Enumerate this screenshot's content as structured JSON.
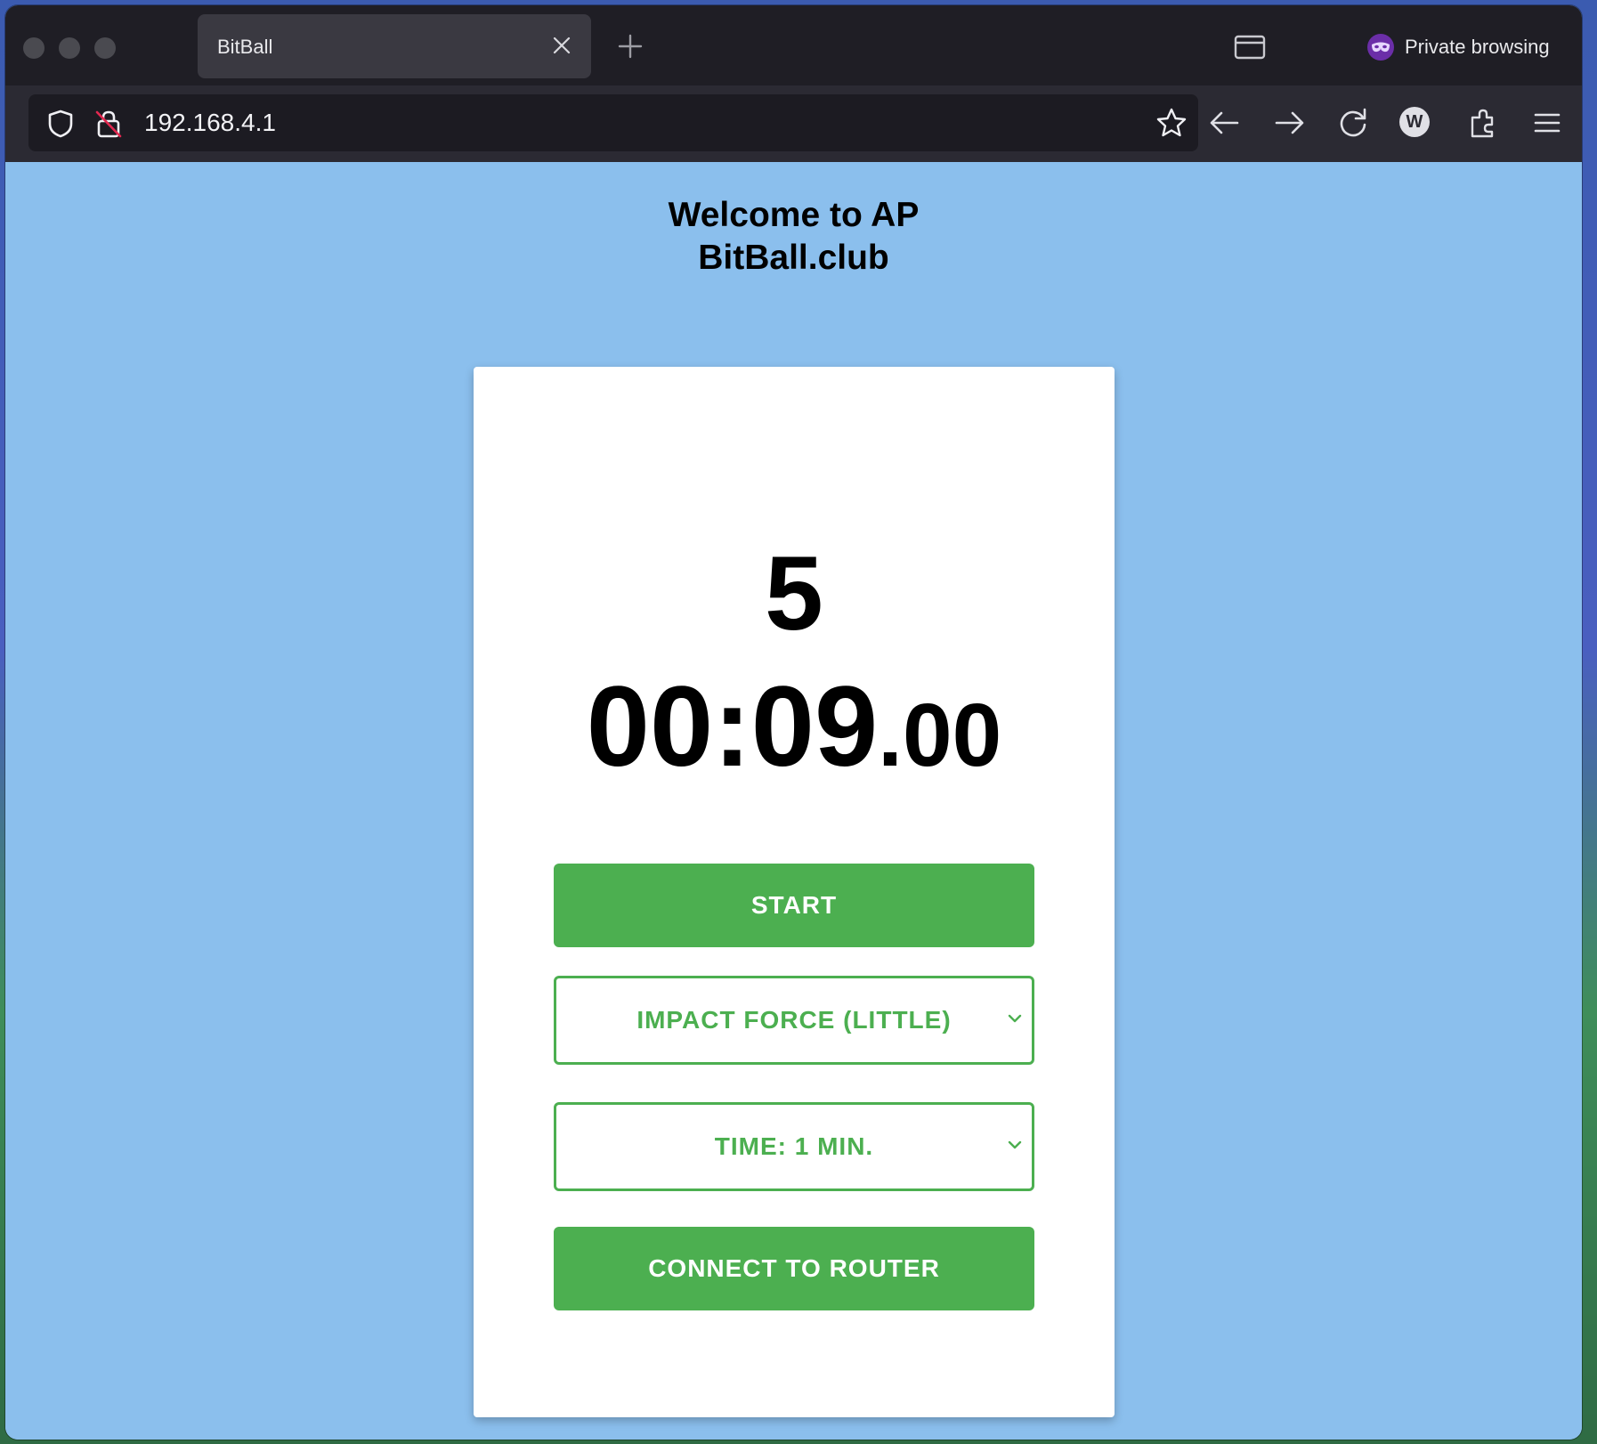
{
  "browser": {
    "tab_title": "BitBall",
    "url": "192.168.4.1",
    "private_label": "Private browsing",
    "extension_letter": "W"
  },
  "page": {
    "heading_line1": "Welcome to AP",
    "heading_line2": "BitBall.club",
    "counter": "5",
    "timer_main": "00:09",
    "timer_fraction": ".00",
    "start_label": "START",
    "impact_select_value": "IMPACT FORCE (LITTLE)",
    "time_select_value": "TIME: 1 MIN.",
    "connect_label": "CONNECT TO ROUTER"
  },
  "colors": {
    "page_background": "#8bbfed",
    "accent_green": "#4caf50",
    "card_background": "#ffffff",
    "private_purple": "#6b2ea8"
  }
}
